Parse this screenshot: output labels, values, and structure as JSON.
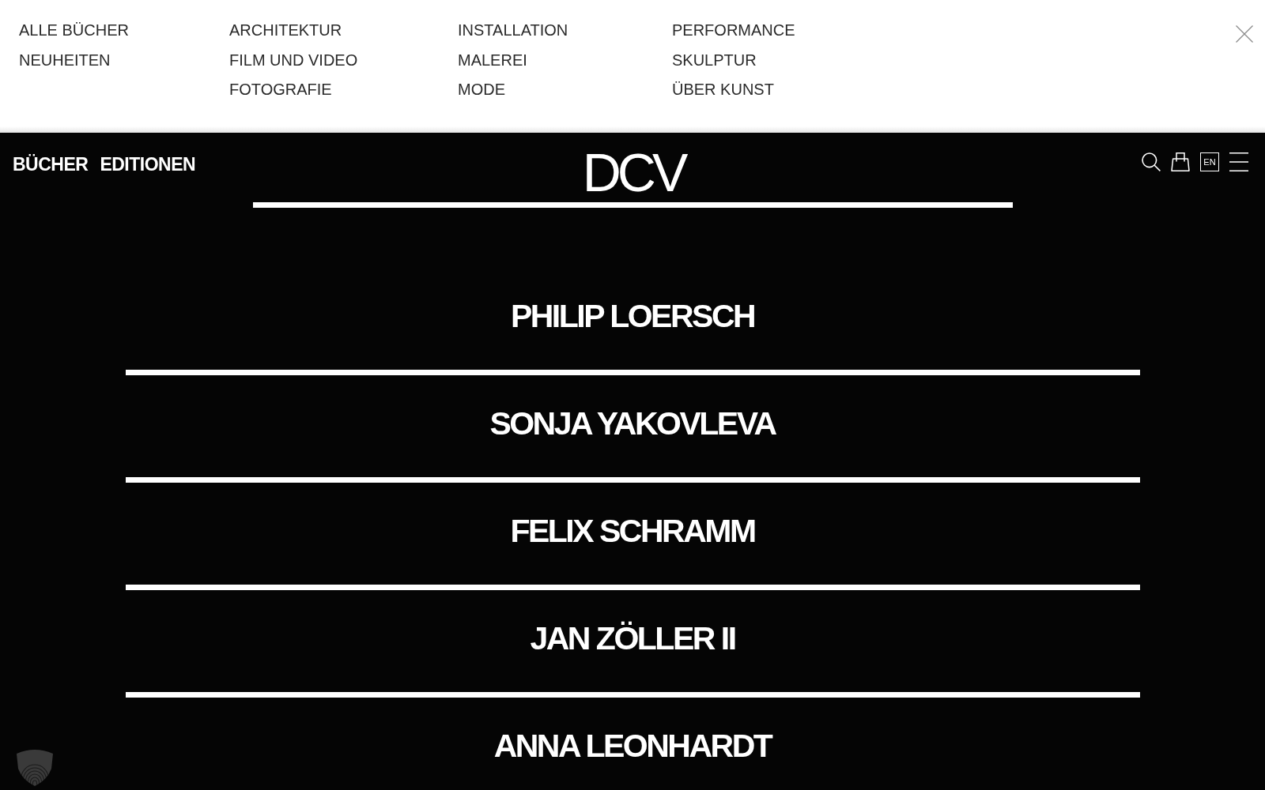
{
  "category_menu": {
    "columns": [
      [
        "ALLE BÜCHER",
        "NEUHEITEN"
      ],
      [
        "ARCHITEKTUR",
        "FILM UND VIDEO",
        "FOTOGRAFIE"
      ],
      [
        "INSTALLATION",
        "MALEREI",
        "MODE"
      ],
      [
        "PERFORMANCE",
        "SKULPTUR",
        "ÜBER KUNST"
      ]
    ]
  },
  "header": {
    "nav": [
      "BÜCHER",
      "EDITIONEN"
    ],
    "logo": "DCV",
    "language": "EN"
  },
  "artists": [
    "PHILIP LOERSCH",
    "SONJA YAKOVLEVA",
    "FELIX SCHRAMM",
    "JAN ZÖLLER II",
    "ANNA LEONHARDT"
  ]
}
